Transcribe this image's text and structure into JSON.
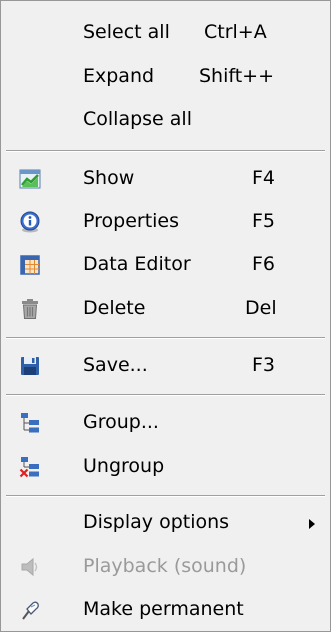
{
  "menu": {
    "select_all": {
      "label": "Select all",
      "shortcut": "Ctrl+A"
    },
    "expand": {
      "label": "Expand",
      "shortcut": "Shift++"
    },
    "collapse_all": {
      "label": "Collapse all"
    },
    "show": {
      "label": "Show",
      "shortcut": "F4",
      "icon": "chart-icon"
    },
    "properties": {
      "label": "Properties",
      "shortcut": "F5",
      "icon": "info-icon"
    },
    "data_editor": {
      "label": "Data Editor",
      "shortcut": "F6",
      "icon": "table-icon"
    },
    "delete": {
      "label": "Delete",
      "shortcut": "Del",
      "icon": "trash-icon"
    },
    "save": {
      "label": "Save...",
      "shortcut": "F3",
      "icon": "floppy-disk-icon"
    },
    "group": {
      "label": "Group...",
      "icon": "group-icon"
    },
    "ungroup": {
      "label": "Ungroup",
      "icon": "ungroup-icon"
    },
    "display_options": {
      "label": "Display options"
    },
    "playback": {
      "label": "Playback (sound)",
      "icon": "speaker-icon",
      "enabled": false
    },
    "make_permanent": {
      "label": "Make permanent",
      "icon": "pin-icon"
    }
  },
  "colors": {
    "menu_background": "#f0f0f0",
    "disabled_text": "#9a9a9a",
    "border": "#979797"
  }
}
